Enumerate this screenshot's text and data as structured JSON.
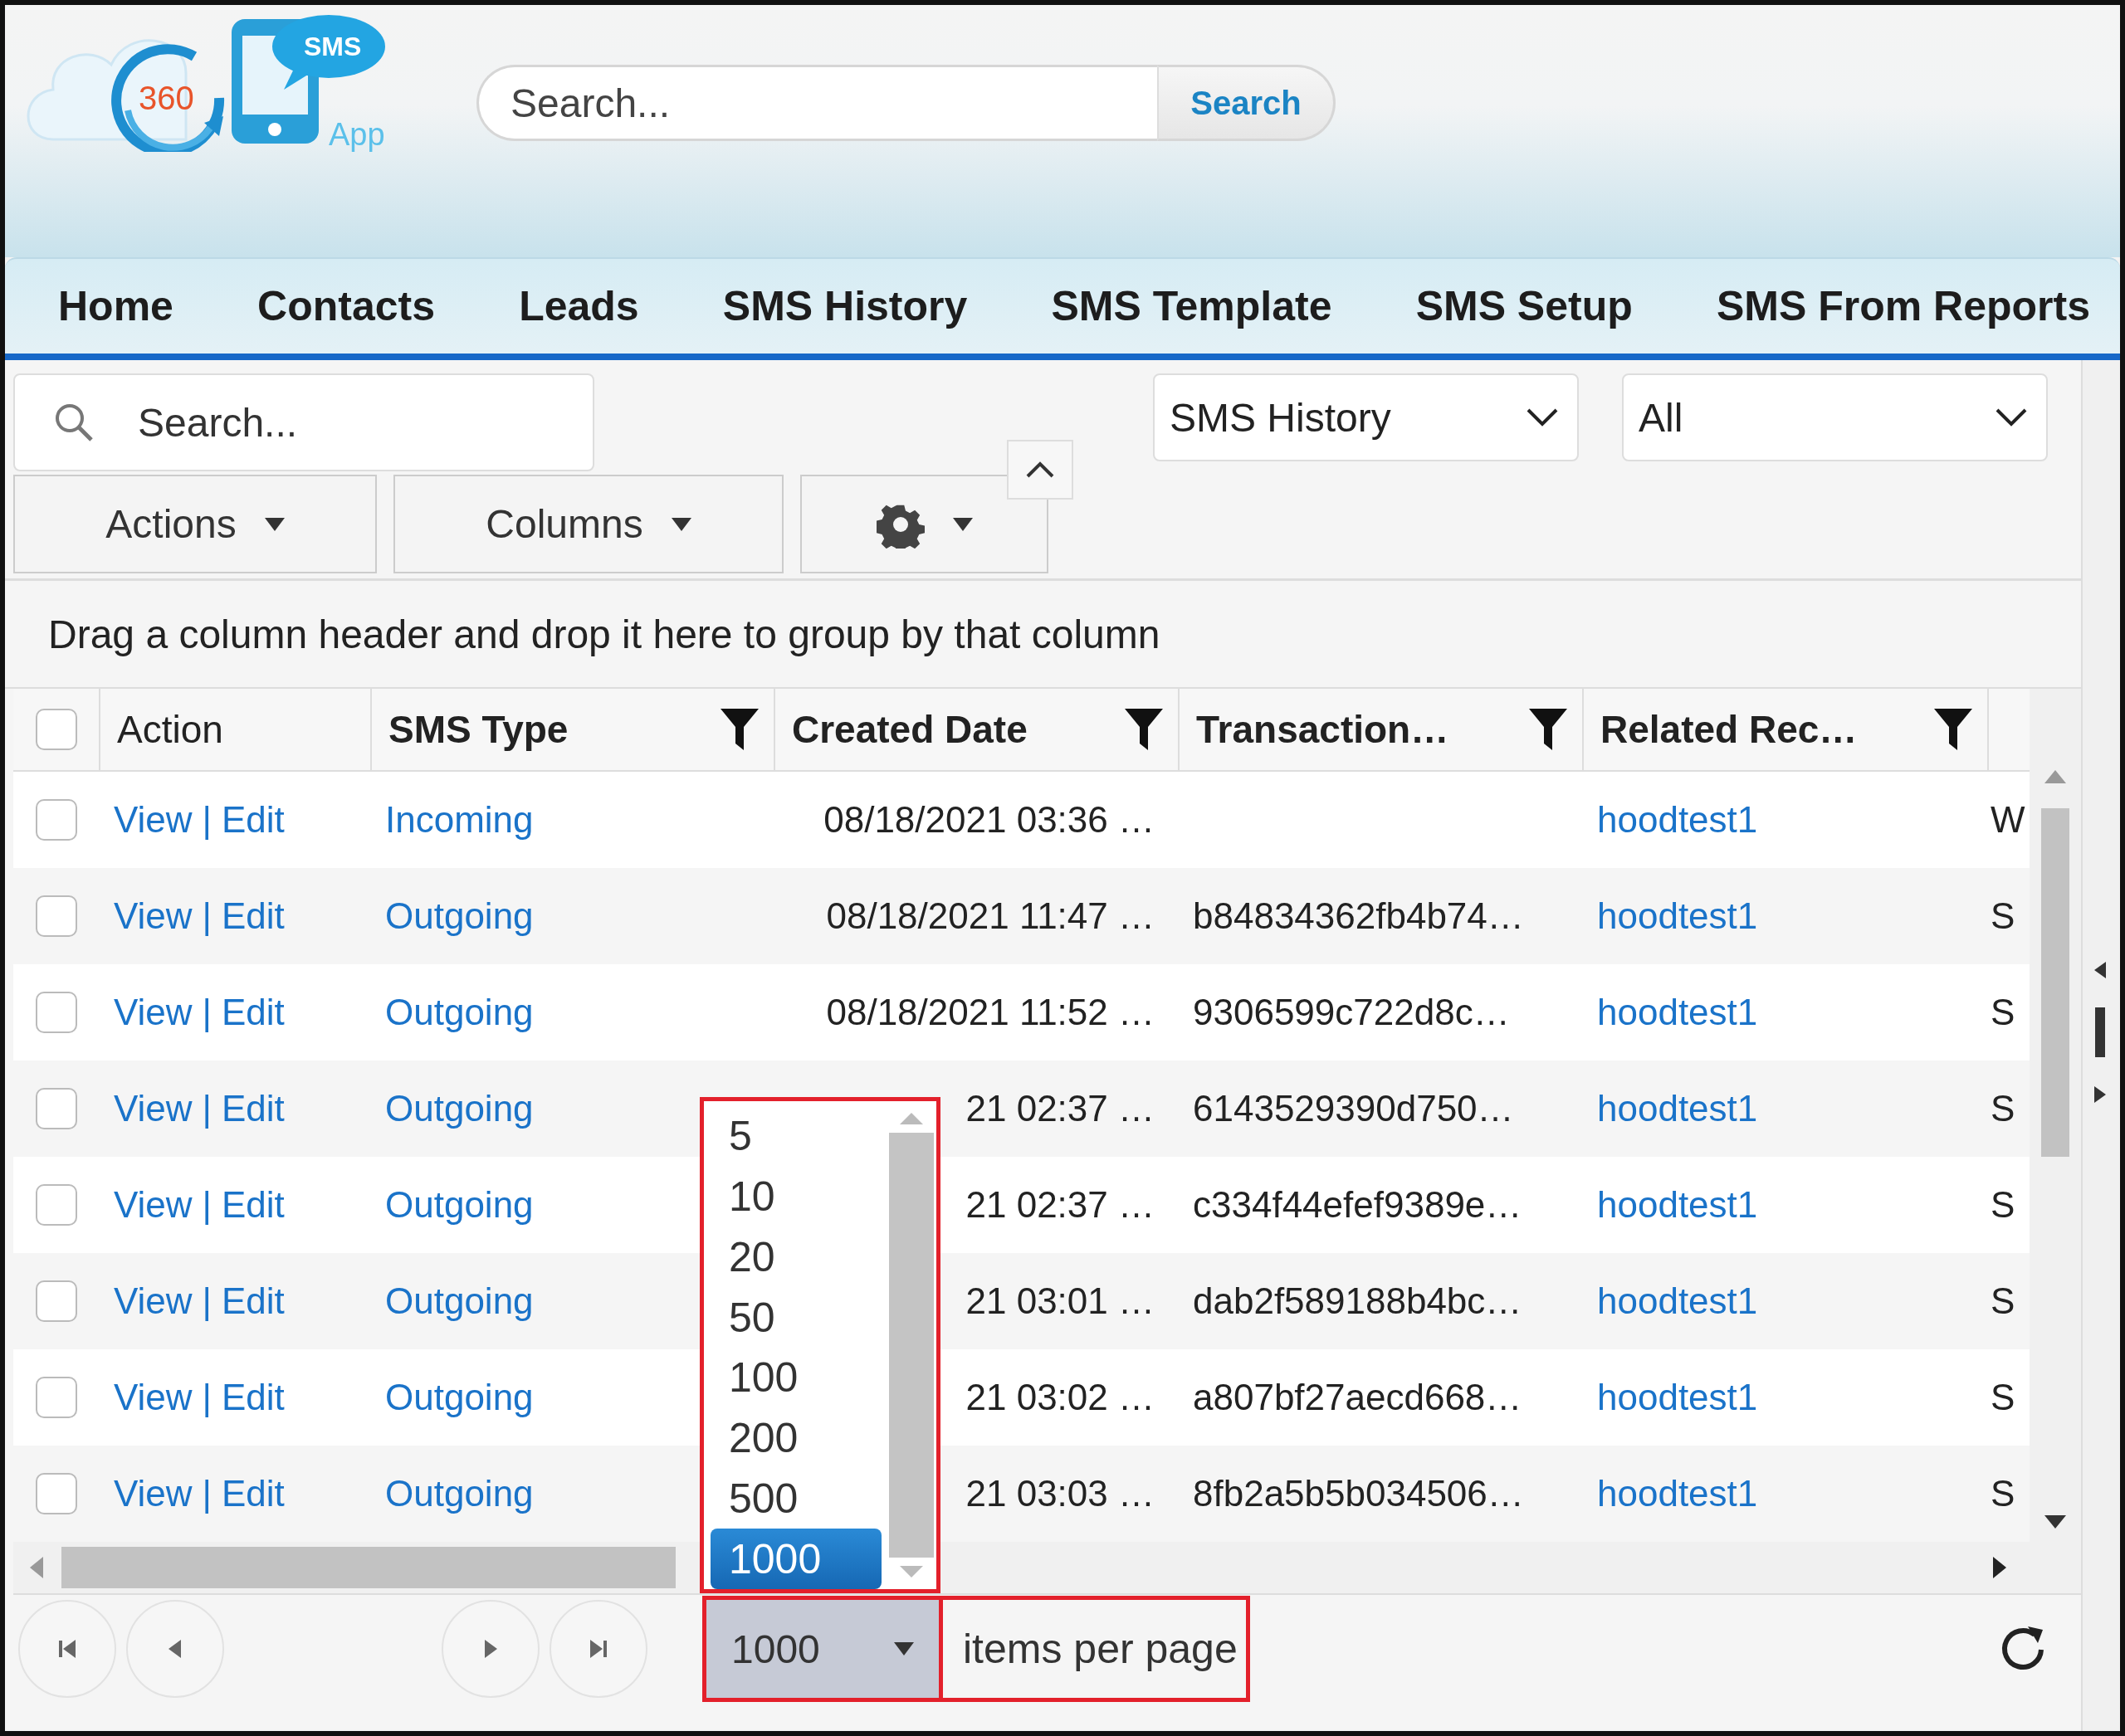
{
  "logo": {
    "number": "360",
    "badge": "SMS",
    "caption": "App"
  },
  "top_search": {
    "placeholder": "Search...",
    "button": "Search"
  },
  "nav": [
    {
      "label": "Home"
    },
    {
      "label": "Contacts"
    },
    {
      "label": "Leads"
    },
    {
      "label": "SMS History"
    },
    {
      "label": "SMS Template"
    },
    {
      "label": "SMS Setup"
    },
    {
      "label": "SMS From Reports"
    }
  ],
  "grid_search": {
    "placeholder": "Search..."
  },
  "selects": [
    {
      "value": "SMS History"
    },
    {
      "value": "All"
    }
  ],
  "toolbar": [
    {
      "kind": "menu",
      "label": "Actions"
    },
    {
      "kind": "menu",
      "label": "Columns"
    },
    {
      "kind": "gear"
    }
  ],
  "group_hint": "Drag a column header and drop it here to group by that column",
  "table": {
    "select_all": {
      "checked": false
    },
    "columns": [
      {
        "label": "Action",
        "filter": false
      },
      {
        "label": "SMS Type",
        "filter": true
      },
      {
        "label": "Created Date",
        "filter": true
      },
      {
        "label": "Transaction…",
        "filter": true
      },
      {
        "label": "Related Rec…",
        "filter": true
      }
    ],
    "rows": [
      {
        "checked": false,
        "view": "View",
        "separator": "|",
        "edit": "Edit",
        "sms_type": "Incoming",
        "created_date": "08/18/2021 03:36 …",
        "related_record": "hoodtest1",
        "column_6": "W"
      },
      {
        "checked": false,
        "view": "View",
        "separator": "|",
        "edit": "Edit",
        "sms_type": "Outgoing",
        "created_date": "08/18/2021 11:47 …",
        "transaction": "b84834362fb4b74…",
        "related_record": "hoodtest1",
        "column_6": "S"
      },
      {
        "checked": false,
        "view": "View",
        "separator": "|",
        "edit": "Edit",
        "sms_type": "Outgoing",
        "created_date": "08/18/2021 11:52 …",
        "transaction": "9306599c722d8c…",
        "related_record": "hoodtest1",
        "column_6": "S"
      },
      {
        "checked": false,
        "view": "View",
        "separator": "|",
        "edit": "Edit",
        "sms_type": "Outgoing",
        "created_date": "21 02:37 …",
        "transaction": "6143529390d750…",
        "related_record": "hoodtest1",
        "column_6": "S"
      },
      {
        "checked": false,
        "view": "View",
        "separator": "|",
        "edit": "Edit",
        "sms_type": "Outgoing",
        "created_date": "21 02:37 …",
        "transaction": "c334f44efef9389e…",
        "related_record": "hoodtest1",
        "column_6": "S"
      },
      {
        "checked": false,
        "view": "View",
        "separator": "|",
        "edit": "Edit",
        "sms_type": "Outgoing",
        "created_date": "21 03:01 …",
        "transaction": "dab2f589188b4bc…",
        "related_record": "hoodtest1",
        "column_6": "S"
      },
      {
        "checked": false,
        "view": "View",
        "separator": "|",
        "edit": "Edit",
        "sms_type": "Outgoing",
        "created_date": "21 03:02 …",
        "transaction": "a807bf27aecd668…",
        "related_record": "hoodtest1",
        "column_6": "S"
      },
      {
        "checked": false,
        "view": "View",
        "separator": "|",
        "edit": "Edit",
        "sms_type": "Outgoing",
        "created_date": "21 03:03 …",
        "transaction": "8fb2a5b5b034506…",
        "related_record": "hoodtest1",
        "column_6": "S"
      }
    ]
  },
  "page_size": {
    "options": [
      {
        "label": "5",
        "selected": false
      },
      {
        "label": "10",
        "selected": false
      },
      {
        "label": "20",
        "selected": false
      },
      {
        "label": "50",
        "selected": false
      },
      {
        "label": "100",
        "selected": false
      },
      {
        "label": "200",
        "selected": false
      },
      {
        "label": "500",
        "selected": false
      },
      {
        "label": "1000",
        "selected": true
      }
    ],
    "value": "1000",
    "label": "items per page"
  }
}
